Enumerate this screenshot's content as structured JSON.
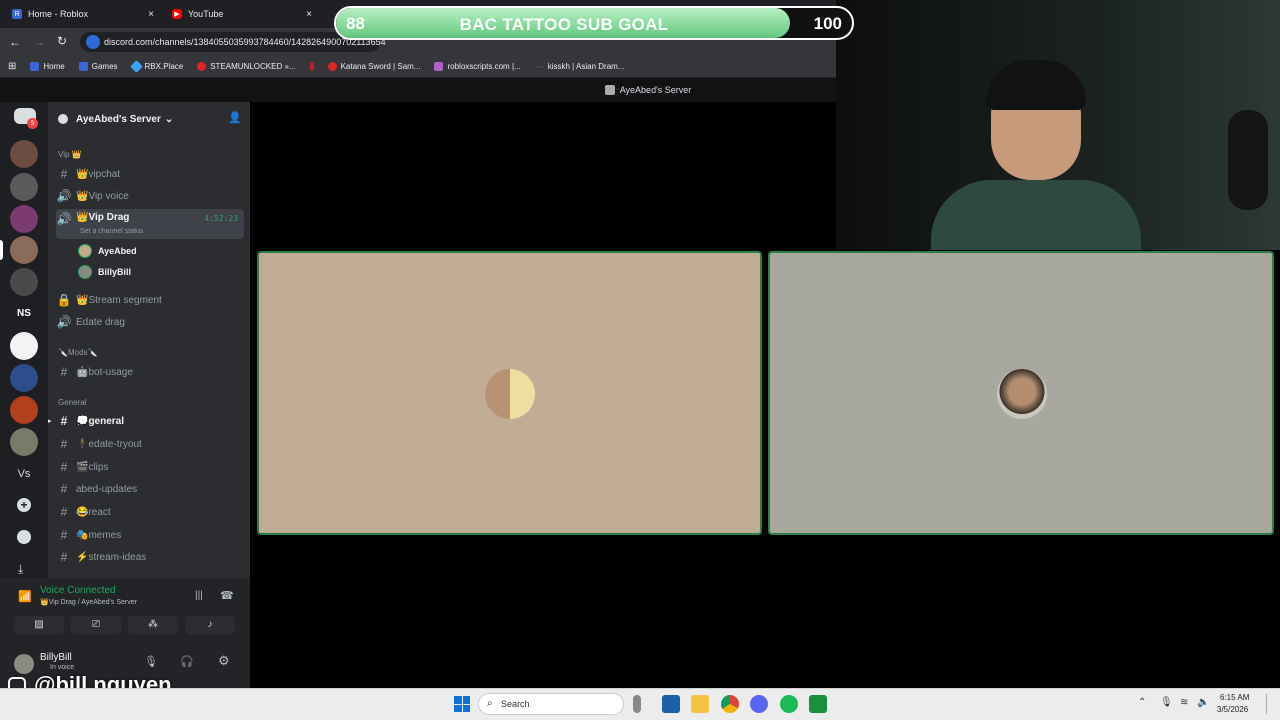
{
  "browser": {
    "tabs": [
      {
        "title": "Home - Roblox",
        "close": "×"
      },
      {
        "title": "YouTube",
        "close": "×"
      }
    ],
    "url": "discord.com/channels/1384055035993784460/1428264900702113654",
    "bookmarks": [
      "Home",
      "Games",
      "RBX.Place",
      "STEAMUNLOCKED »...",
      "Katana Sword | Sam...",
      "robloxscripts.com |...",
      "kisskh | Asian Dram..."
    ]
  },
  "goal": {
    "current": "88",
    "title": "BAC TATTOO SUB GOAL",
    "target": "100",
    "progress": 0.88
  },
  "discord": {
    "window_title": "AyeAbed's Server",
    "server_badge": "5",
    "server_name": "AyeAbed's Server",
    "categories": {
      "vip": "Vip 👑",
      "mods": "🔪Mods🔪",
      "general": "General"
    },
    "channels": {
      "vipchat": "👑vipchat",
      "vip_voice": "👑Vip voice",
      "vip_drag": "👑Vip Drag",
      "vip_drag_timer": "4:52:23",
      "vip_drag_status": "Set a channel status",
      "member1": "AyeAbed",
      "member2": "BillyBill",
      "stream_segment": "👑Stream segment",
      "edate_drag": "Edate drag",
      "bot_usage": "🤖bot-usage",
      "general": "💭general",
      "edate_tryout": "🕴edate-tryout",
      "clips": "🎬clips",
      "abed_updates": "abed-updates",
      "react": "😂react",
      "memes": "🎭memes",
      "stream_ideas": "⚡stream-ideas"
    },
    "voice": {
      "status": "Voice Connected",
      "location": "👑Vip Drag / AyeAbed's Server"
    },
    "user": {
      "name": "BillyBill",
      "status": "In voice"
    }
  },
  "overlay": {
    "handle": "@bill.nguyen"
  },
  "taskbar": {
    "search_placeholder": "Search",
    "time": "6:15 AM",
    "date": "3/5/2026"
  },
  "colors": {
    "accent_green": "#23a55a",
    "tile_border": "#2d7d46",
    "tile1_bg": "#c1ad94",
    "tile2_bg": "#a9a89f",
    "goal_fill": "#7fd694"
  }
}
